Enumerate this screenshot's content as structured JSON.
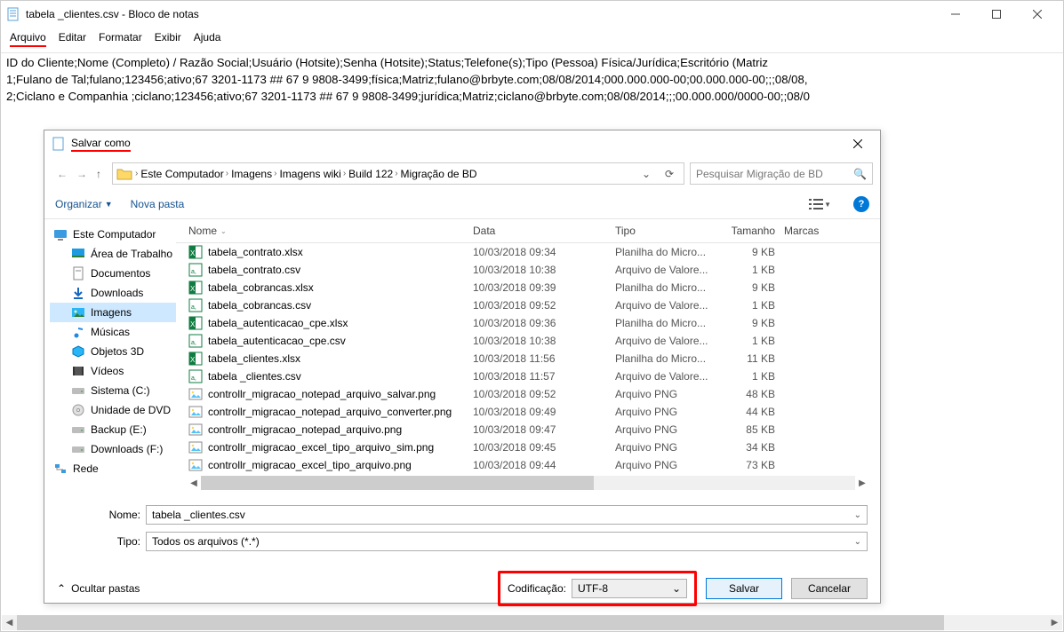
{
  "window": {
    "title": "tabela _clientes.csv - Bloco de notas"
  },
  "menu": {
    "file": "Arquivo",
    "edit": "Editar",
    "format": "Formatar",
    "view": "Exibir",
    "help": "Ajuda"
  },
  "editor": {
    "line1": "ID do Cliente;Nome (Completo) / Razão Social;Usuário (Hotsite);Senha (Hotsite);Status;Telefone(s);Tipo (Pessoa) Física/Jurídica;Escritório (Matriz",
    "line2": "1;Fulano de Tal;fulano;123456;ativo;67 3201-1173 ## 67 9 9808-3499;física;Matriz;fulano@brbyte.com;08/08/2014;000.000.000-00;00.000.000-00;;;08/08,",
    "line3": "2;Ciclano e Companhia ;ciclano;123456;ativo;67 3201-1173 ## 67 9 9808-3499;jurídica;Matriz;ciclano@brbyte.com;08/08/2014;;;00.000.000/0000-00;;08/0"
  },
  "dialog": {
    "title": "Salvar como",
    "breadcrumbs": [
      "Este Computador",
      "Imagens",
      "Imagens wiki",
      "Build 122",
      "Migração de BD"
    ],
    "search_placeholder": "Pesquisar Migração de BD",
    "organize": "Organizar",
    "new_folder": "Nova pasta",
    "hide_folders": "Ocultar pastas",
    "name_label": "Nome:",
    "type_label": "Tipo:",
    "encoding_label": "Codificação:",
    "name_value": "tabela _clientes.csv",
    "type_value": "Todos os arquivos  (*.*)",
    "encoding_value": "UTF-8",
    "save": "Salvar",
    "cancel": "Cancelar"
  },
  "tree": [
    {
      "label": "Este Computador",
      "icon": "pc"
    },
    {
      "label": "Área de Trabalho",
      "icon": "desktop",
      "indent": true
    },
    {
      "label": "Documentos",
      "icon": "docs",
      "indent": true
    },
    {
      "label": "Downloads",
      "icon": "dl",
      "indent": true
    },
    {
      "label": "Imagens",
      "icon": "img",
      "indent": true,
      "selected": true
    },
    {
      "label": "Músicas",
      "icon": "music",
      "indent": true
    },
    {
      "label": "Objetos 3D",
      "icon": "obj3d",
      "indent": true
    },
    {
      "label": "Vídeos",
      "icon": "video",
      "indent": true
    },
    {
      "label": "Sistema (C:)",
      "icon": "drive",
      "indent": true
    },
    {
      "label": "Unidade de DVD",
      "icon": "dvd",
      "indent": true
    },
    {
      "label": "Backup (E:)",
      "icon": "drive",
      "indent": true
    },
    {
      "label": "Downloads (F:)",
      "icon": "drive",
      "indent": true
    },
    {
      "label": "Rede",
      "icon": "net"
    }
  ],
  "columns": {
    "name": "Nome",
    "date": "Data",
    "type": "Tipo",
    "size": "Tamanho",
    "marks": "Marcas"
  },
  "files": [
    {
      "name": "tabela_contrato.xlsx",
      "date": "10/03/2018 09:34",
      "type": "Planilha do Micro...",
      "size": "9 KB",
      "icon": "xlsx"
    },
    {
      "name": "tabela_contrato.csv",
      "date": "10/03/2018 10:38",
      "type": "Arquivo de Valore...",
      "size": "1 KB",
      "icon": "csv"
    },
    {
      "name": "tabela_cobrancas.xlsx",
      "date": "10/03/2018 09:39",
      "type": "Planilha do Micro...",
      "size": "9 KB",
      "icon": "xlsx"
    },
    {
      "name": "tabela_cobrancas.csv",
      "date": "10/03/2018 09:52",
      "type": "Arquivo de Valore...",
      "size": "1 KB",
      "icon": "csv"
    },
    {
      "name": "tabela_autenticacao_cpe.xlsx",
      "date": "10/03/2018 09:36",
      "type": "Planilha do Micro...",
      "size": "9 KB",
      "icon": "xlsx"
    },
    {
      "name": "tabela_autenticacao_cpe.csv",
      "date": "10/03/2018 10:38",
      "type": "Arquivo de Valore...",
      "size": "1 KB",
      "icon": "csv"
    },
    {
      "name": "tabela_clientes.xlsx",
      "date": "10/03/2018 11:56",
      "type": "Planilha do Micro...",
      "size": "11 KB",
      "icon": "xlsx"
    },
    {
      "name": "tabela _clientes.csv",
      "date": "10/03/2018 11:57",
      "type": "Arquivo de Valore...",
      "size": "1 KB",
      "icon": "csv"
    },
    {
      "name": "controllr_migracao_notepad_arquivo_salvar.png",
      "date": "10/03/2018 09:52",
      "type": "Arquivo PNG",
      "size": "48 KB",
      "icon": "png"
    },
    {
      "name": "controllr_migracao_notepad_arquivo_converter.png",
      "date": "10/03/2018 09:49",
      "type": "Arquivo PNG",
      "size": "44 KB",
      "icon": "png"
    },
    {
      "name": "controllr_migracao_notepad_arquivo.png",
      "date": "10/03/2018 09:47",
      "type": "Arquivo PNG",
      "size": "85 KB",
      "icon": "png"
    },
    {
      "name": "controllr_migracao_excel_tipo_arquivo_sim.png",
      "date": "10/03/2018 09:45",
      "type": "Arquivo PNG",
      "size": "34 KB",
      "icon": "png"
    },
    {
      "name": "controllr_migracao_excel_tipo_arquivo.png",
      "date": "10/03/2018 09:44",
      "type": "Arquivo PNG",
      "size": "73 KB",
      "icon": "png"
    }
  ]
}
